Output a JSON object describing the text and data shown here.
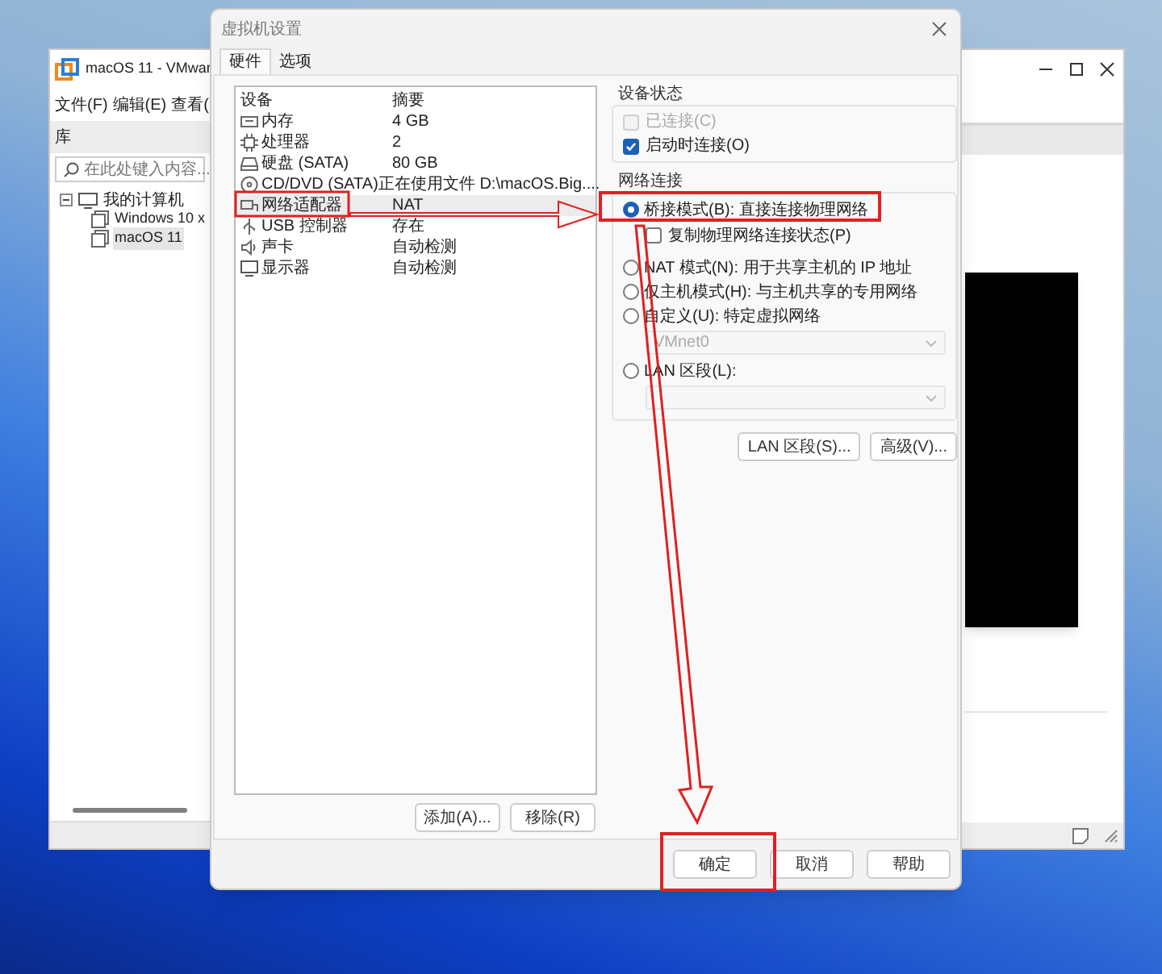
{
  "vmware_window": {
    "title": "macOS 11 - VMwar",
    "menu": [
      "文件(F)",
      "编辑(E)",
      "查看("
    ],
    "library": {
      "title": "库",
      "search_placeholder": "在此处键入内容...",
      "tree": [
        {
          "label": "我的计算机",
          "expanded": true,
          "children": [
            {
              "label": "Windows 10 x",
              "selected": false
            },
            {
              "label": "macOS 11",
              "selected": true
            }
          ]
        }
      ]
    }
  },
  "dialog": {
    "title": "虚拟机设置",
    "tabs": [
      {
        "label": "硬件",
        "selected": true
      },
      {
        "label": "选项",
        "selected": false
      }
    ],
    "devices": {
      "columns": [
        "设备",
        "摘要"
      ],
      "rows": [
        {
          "kind": "memory",
          "device": "内存",
          "summary": "4 GB",
          "selected": false
        },
        {
          "kind": "cpu",
          "device": "处理器",
          "summary": "2",
          "selected": false
        },
        {
          "kind": "disk",
          "device": "硬盘 (SATA)",
          "summary": "80 GB",
          "selected": false
        },
        {
          "kind": "cd",
          "device": "CD/DVD (SATA)",
          "summary": "正在使用文件 D:\\macOS.Big....",
          "selected": false
        },
        {
          "kind": "network",
          "device": "网络适配器",
          "summary": "NAT",
          "selected": true
        },
        {
          "kind": "usb",
          "device": "USB 控制器",
          "summary": "存在",
          "selected": false
        },
        {
          "kind": "sound",
          "device": "声卡",
          "summary": "自动检测",
          "selected": false
        },
        {
          "kind": "display",
          "device": "显示器",
          "summary": "自动检测",
          "selected": false
        }
      ]
    },
    "device_buttons": [
      "添加(A)...",
      "移除(R)"
    ],
    "device_status": {
      "title": "设备状态",
      "options": [
        {
          "label": "已连接(C)",
          "checked": false,
          "disabled": true
        },
        {
          "label": "启动时连接(O)",
          "checked": true,
          "disabled": false
        }
      ]
    },
    "network_connection": {
      "title": "网络连接",
      "options": [
        {
          "kind": "radio",
          "label": "桥接模式(B): 直接连接物理网络",
          "selected": true
        },
        {
          "kind": "checkbox",
          "label": "复制物理网络连接状态(P)",
          "checked": false
        },
        {
          "kind": "radio",
          "label": "NAT 模式(N): 用于共享主机的 IP 地址",
          "selected": false
        },
        {
          "kind": "radio",
          "label": "仅主机模式(H): 与主机共享的专用网络",
          "selected": false
        },
        {
          "kind": "radio",
          "label": "自定义(U): 特定虚拟网络",
          "selected": false
        },
        {
          "kind": "dropdown",
          "value": "VMnet0",
          "disabled": true
        },
        {
          "kind": "radio",
          "label": "LAN 区段(L):",
          "selected": false
        },
        {
          "kind": "dropdown",
          "disabled": true
        }
      ]
    },
    "network_buttons": [
      "LAN 区段(S)...",
      "高级(V)..."
    ],
    "footer_buttons": [
      "确定",
      "取消",
      "帮助"
    ]
  }
}
